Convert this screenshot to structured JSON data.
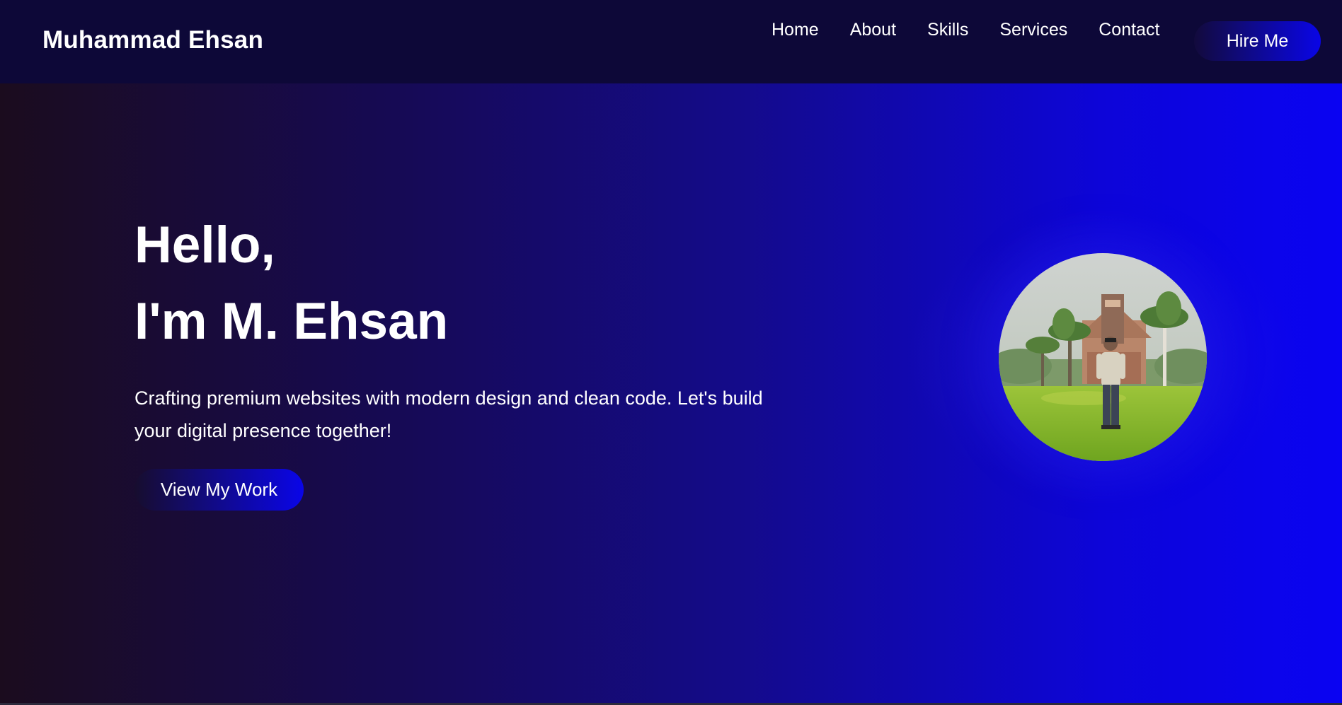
{
  "navbar": {
    "brand": "Muhammad Ehsan",
    "links": [
      "Home",
      "About",
      "Skills",
      "Services",
      "Contact"
    ],
    "hire_label": "Hire Me"
  },
  "hero": {
    "greeting": "Hello,",
    "name_line": "I'm M. Ehsan",
    "description": "Crafting premium websites with modern design and clean code. Let's build your digital presence together!",
    "cta_label": "View My Work"
  },
  "colors": {
    "nav_bg": "#0d0838",
    "accent_blue": "#0a03f2",
    "dark_left": "#1b0c1e",
    "text": "#ffffff"
  },
  "icons": {
    "avatar": "profile-photo"
  }
}
